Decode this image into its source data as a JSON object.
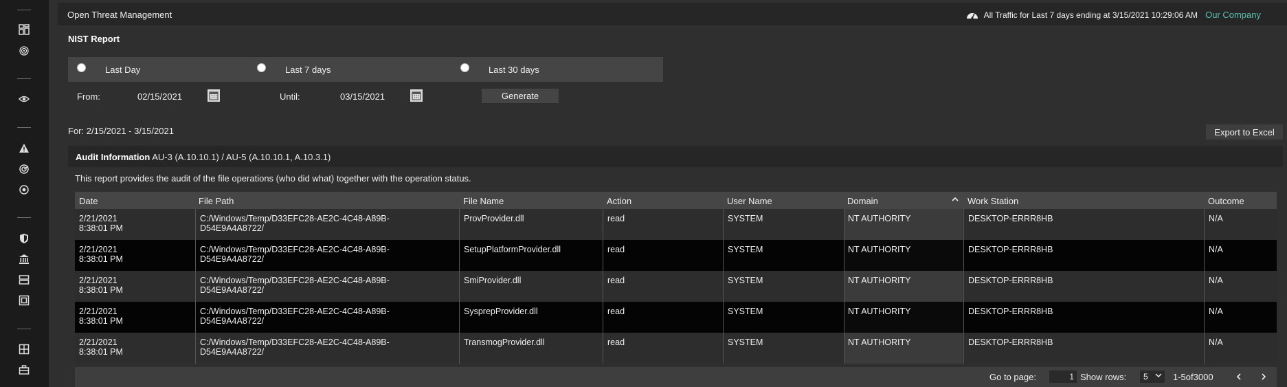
{
  "header": {
    "app_title": "Open Threat Management",
    "traffic_text": "All Traffic for Last 7 days ending at 3/15/2021 10:29:06 AM",
    "company": "Our Company"
  },
  "sidebar": {
    "icons": [
      "dashboard-icon",
      "fingerprint-icon",
      "eye-icon",
      "alert-triangle-icon",
      "radar-icon",
      "target-icon",
      "shield-icon",
      "bank-icon",
      "server-icon",
      "report-icon",
      "grid-plus-icon",
      "toolbox-icon"
    ]
  },
  "report": {
    "title": "NIST Report",
    "ranges": [
      {
        "label": "Last Day"
      },
      {
        "label": "Last 7 days"
      },
      {
        "label": "Last 30 days"
      }
    ],
    "from_label": "From:",
    "from_value": "02/15/2021",
    "until_label": "Until:",
    "until_value": "03/15/2021",
    "generate_label": "Generate",
    "for_range": "For: 2/15/2021 - 3/15/2021",
    "export_label": "Export to Excel"
  },
  "audit": {
    "heading_bold": "Audit Information",
    "heading_rest": " AU-3 (A.10.10.1) / AU-5 (A.10.10.1, A.10.3.1)",
    "description": "This report provides the audit of the file operations (who did what) together with the operation status."
  },
  "table": {
    "columns": [
      "Date",
      "File Path",
      "File Name",
      "Action",
      "User Name",
      "Domain",
      "Work Station",
      "Outcome"
    ],
    "sorted_column": "Domain",
    "rows": [
      {
        "date1": "2/21/2021",
        "date2": "8:38:01 PM",
        "path1": "C:/Windows/Temp/D33EFC28-AE2C-4C48-A89B-",
        "path2": "D54E9A4A8722/",
        "file": "ProvProvider.dll",
        "action": "read",
        "user": "SYSTEM",
        "domain": "NT AUTHORITY",
        "ws": "DESKTOP-ERRR8HB",
        "outcome": "N/A"
      },
      {
        "date1": "2/21/2021",
        "date2": "8:38:01 PM",
        "path1": "C:/Windows/Temp/D33EFC28-AE2C-4C48-A89B-",
        "path2": "D54E9A4A8722/",
        "file": "SetupPlatformProvider.dll",
        "action": "read",
        "user": "SYSTEM",
        "domain": "NT AUTHORITY",
        "ws": "DESKTOP-ERRR8HB",
        "outcome": "N/A"
      },
      {
        "date1": "2/21/2021",
        "date2": "8:38:01 PM",
        "path1": "C:/Windows/Temp/D33EFC28-AE2C-4C48-A89B-",
        "path2": "D54E9A4A8722/",
        "file": "SmiProvider.dll",
        "action": "read",
        "user": "SYSTEM",
        "domain": "NT AUTHORITY",
        "ws": "DESKTOP-ERRR8HB",
        "outcome": "N/A"
      },
      {
        "date1": "2/21/2021",
        "date2": "8:38:01 PM",
        "path1": "C:/Windows/Temp/D33EFC28-AE2C-4C48-A89B-",
        "path2": "D54E9A4A8722/",
        "file": "SysprepProvider.dll",
        "action": "read",
        "user": "SYSTEM",
        "domain": "NT AUTHORITY",
        "ws": "DESKTOP-ERRR8HB",
        "outcome": "N/A"
      },
      {
        "date1": "2/21/2021",
        "date2": "8:38:01 PM",
        "path1": "C:/Windows/Temp/D33EFC28-AE2C-4C48-A89B-",
        "path2": "D54E9A4A8722/",
        "file": "TransmogProvider.dll",
        "action": "read",
        "user": "SYSTEM",
        "domain": "NT AUTHORITY",
        "ws": "DESKTOP-ERRR8HB",
        "outcome": "N/A"
      }
    ]
  },
  "pager": {
    "goto_label": "Go to page:",
    "page_value": "1",
    "rows_label": "Show rows:",
    "rows_value": "5",
    "range_text": "1-5of3000"
  },
  "colors": {
    "accent": "#5bc0b0",
    "sidebar": "#1b1b1b",
    "background": "#2f2f2f"
  }
}
